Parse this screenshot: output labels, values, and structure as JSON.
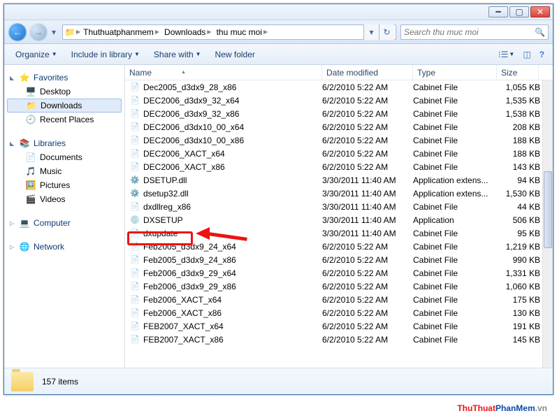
{
  "breadcrumbs": [
    "Thuthuatphanmem",
    "Downloads",
    "thu muc moi"
  ],
  "search_placeholder": "Search thu muc moi",
  "toolbar": {
    "organize": "Organize",
    "include": "Include in library",
    "share": "Share with",
    "newfolder": "New folder"
  },
  "columns": {
    "name": "Name",
    "date": "Date modified",
    "type": "Type",
    "size": "Size"
  },
  "nav": {
    "favorites": "Favorites",
    "desktop": "Desktop",
    "downloads": "Downloads",
    "recent": "Recent Places",
    "libraries": "Libraries",
    "documents": "Documents",
    "music": "Music",
    "pictures": "Pictures",
    "videos": "Videos",
    "computer": "Computer",
    "network": "Network"
  },
  "files": [
    {
      "name": "Dec2005_d3dx9_28_x86",
      "date": "6/2/2010 5:22 AM",
      "type": "Cabinet File",
      "size": "1,055 KB",
      "icon": "cab"
    },
    {
      "name": "DEC2006_d3dx9_32_x64",
      "date": "6/2/2010 5:22 AM",
      "type": "Cabinet File",
      "size": "1,535 KB",
      "icon": "cab"
    },
    {
      "name": "DEC2006_d3dx9_32_x86",
      "date": "6/2/2010 5:22 AM",
      "type": "Cabinet File",
      "size": "1,538 KB",
      "icon": "cab"
    },
    {
      "name": "DEC2006_d3dx10_00_x64",
      "date": "6/2/2010 5:22 AM",
      "type": "Cabinet File",
      "size": "208 KB",
      "icon": "cab"
    },
    {
      "name": "DEC2006_d3dx10_00_x86",
      "date": "6/2/2010 5:22 AM",
      "type": "Cabinet File",
      "size": "188 KB",
      "icon": "cab"
    },
    {
      "name": "DEC2006_XACT_x64",
      "date": "6/2/2010 5:22 AM",
      "type": "Cabinet File",
      "size": "188 KB",
      "icon": "cab"
    },
    {
      "name": "DEC2006_XACT_x86",
      "date": "6/2/2010 5:22 AM",
      "type": "Cabinet File",
      "size": "143 KB",
      "icon": "cab"
    },
    {
      "name": "DSETUP.dll",
      "date": "3/30/2011 11:40 AM",
      "type": "Application extens...",
      "size": "94 KB",
      "icon": "dll"
    },
    {
      "name": "dsetup32.dll",
      "date": "3/30/2011 11:40 AM",
      "type": "Application extens...",
      "size": "1,530 KB",
      "icon": "dll"
    },
    {
      "name": "dxdllreg_x86",
      "date": "3/30/2011 11:40 AM",
      "type": "Cabinet File",
      "size": "44 KB",
      "icon": "cab"
    },
    {
      "name": "DXSETUP",
      "date": "3/30/2011 11:40 AM",
      "type": "Application",
      "size": "506 KB",
      "icon": "app"
    },
    {
      "name": "dxupdate",
      "date": "3/30/2011 11:40 AM",
      "type": "Cabinet File",
      "size": "95 KB",
      "icon": "cab"
    },
    {
      "name": "Feb2005_d3dx9_24_x64",
      "date": "6/2/2010 5:22 AM",
      "type": "Cabinet File",
      "size": "1,219 KB",
      "icon": "cab"
    },
    {
      "name": "Feb2005_d3dx9_24_x86",
      "date": "6/2/2010 5:22 AM",
      "type": "Cabinet File",
      "size": "990 KB",
      "icon": "cab"
    },
    {
      "name": "Feb2006_d3dx9_29_x64",
      "date": "6/2/2010 5:22 AM",
      "type": "Cabinet File",
      "size": "1,331 KB",
      "icon": "cab"
    },
    {
      "name": "Feb2006_d3dx9_29_x86",
      "date": "6/2/2010 5:22 AM",
      "type": "Cabinet File",
      "size": "1,060 KB",
      "icon": "cab"
    },
    {
      "name": "Feb2006_XACT_x64",
      "date": "6/2/2010 5:22 AM",
      "type": "Cabinet File",
      "size": "175 KB",
      "icon": "cab"
    },
    {
      "name": "Feb2006_XACT_x86",
      "date": "6/2/2010 5:22 AM",
      "type": "Cabinet File",
      "size": "130 KB",
      "icon": "cab"
    },
    {
      "name": "FEB2007_XACT_x64",
      "date": "6/2/2010 5:22 AM",
      "type": "Cabinet File",
      "size": "191 KB",
      "icon": "cab"
    },
    {
      "name": "FEB2007_XACT_x86",
      "date": "6/2/2010 5:22 AM",
      "type": "Cabinet File",
      "size": "145 KB",
      "icon": "cab"
    }
  ],
  "status_items": "157 items",
  "watermark": {
    "a": "ThuThuat",
    "b": "PhanMem",
    "c": ".vn"
  }
}
